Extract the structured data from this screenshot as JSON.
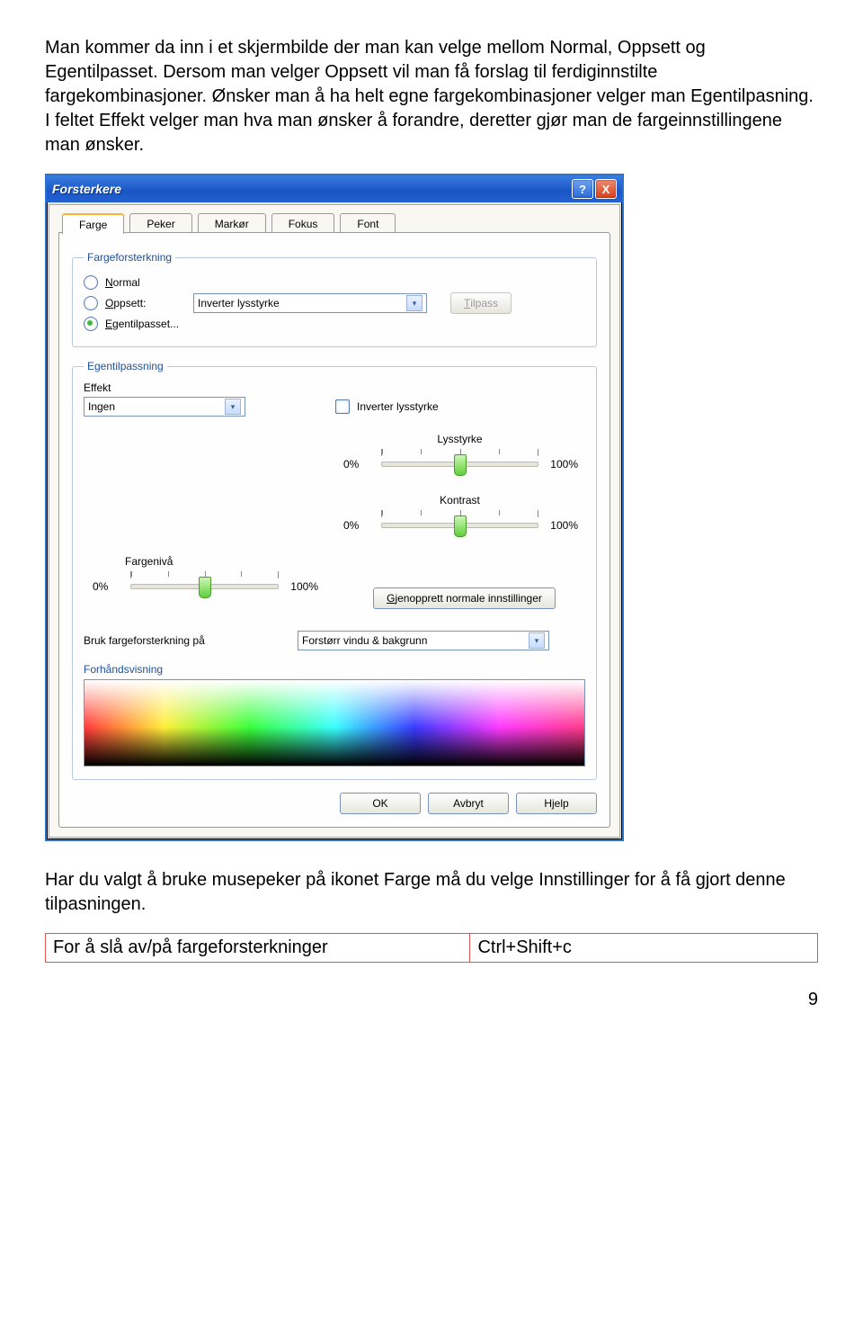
{
  "doc": {
    "p1": "Man kommer da inn i et skjermbilde der man kan velge mellom Normal, Oppsett og Egentilpasset. Dersom man velger Oppsett vil man få forslag til ferdiginnstilte fargekombinasjoner. Ønsker man å ha helt egne fargekombinasjoner velger man Egentilpasning. I feltet Effekt velger man hva man ønsker å forandre, deretter gjør man de fargeinnstillingene man ønsker.",
    "p2": "Har du valgt å bruke musepeker på ikonet Farge må du velge Innstillinger for å få gjort denne tilpasningen.",
    "shortcut_label": "For å slå av/på fargeforsterkninger",
    "shortcut_key": "Ctrl+Shift+c",
    "page": "9"
  },
  "win": {
    "title": "Forsterkere",
    "tabs": [
      "Farge",
      "Peker",
      "Markør",
      "Fokus",
      "Font"
    ],
    "group1": {
      "legend": "Fargeforsterkning",
      "opt_normal": "Normal",
      "opt_oppsett": "Oppsett:",
      "opt_egentil": "Egentilpasset...",
      "combo": "Inverter lysstyrke",
      "tilpass": "Tilpass"
    },
    "group2": {
      "legend": "Egentilpassning",
      "effekt_label": "Effekt",
      "effekt_value": "Ingen",
      "invert": "Inverter lysstyrke",
      "lys_label": "Lysstyrke",
      "kontrast_label": "Kontrast",
      "fargen_label": "Fargenivå",
      "min": "0%",
      "max": "100%",
      "gjenopprett": "Gjenopprett normale innstillinger",
      "bruk_label": "Bruk fargeforsterkning på",
      "bruk_value": "Forstørr vindu & bakgrunn",
      "preview_label": "Forhåndsvisning"
    },
    "buttons": {
      "ok": "OK",
      "cancel": "Avbryt",
      "help": "Hjelp"
    }
  }
}
